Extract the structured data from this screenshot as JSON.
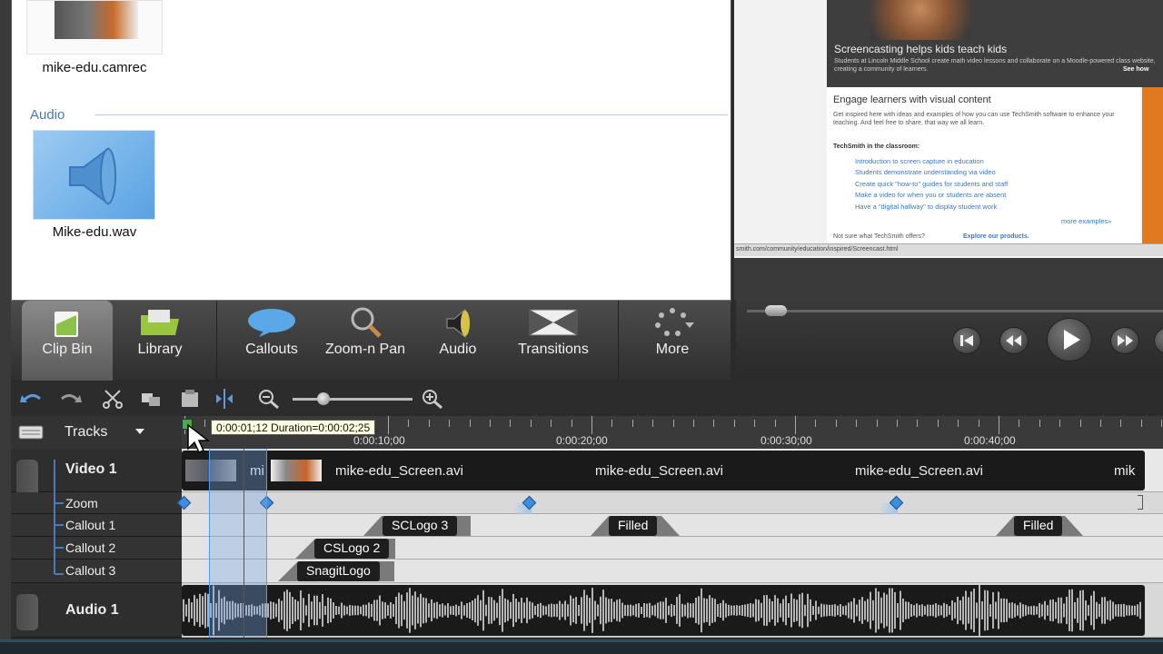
{
  "clip_bin": {
    "video_clip": {
      "label": "mike-edu.camrec"
    },
    "audio_section": {
      "header": "Audio"
    },
    "audio_clip": {
      "label": "Mike-edu.wav"
    }
  },
  "preview": {
    "banner_title": "Screencasting helps kids teach kids",
    "banner_sub": "Students at Lincoln Middle School create math video lessons and collaborate on a Moodle-powered class website, creating a community of learners.",
    "see_how": "See how",
    "heading": "Engage learners with visual content",
    "intro": "Get inspired here with ideas and examples of how you can use TechSmith software to enhance your teaching. And feel free to share, that way we all learn.",
    "share": "share,",
    "subheading": "TechSmith in the classroom:",
    "links": [
      "Introduction to screen capture in education",
      "Students demonstrate understanding via video",
      "Create quick \"how-to\" guides for students and staff",
      "Make a video for when you or students are absent",
      "Have a \"digital hallway\" to display student work"
    ],
    "more_examples": "more examples»",
    "footer_q": "Not sure what TechSmith offers?",
    "footer_link": "Explore our products.",
    "status_url": "smith.com/community/education/inspired/Screencast.html"
  },
  "toolbar": {
    "tabs": [
      {
        "label": "Clip Bin",
        "icon": "clip-bin-icon",
        "active": true
      },
      {
        "label": "Library",
        "icon": "library-folder-icon"
      },
      {
        "label": "Callouts",
        "icon": "speech-bubble-icon"
      },
      {
        "label": "Zoom-n Pan",
        "icon": "magnifier-icon"
      },
      {
        "label": "Audio",
        "icon": "speaker-icon"
      },
      {
        "label": "Transitions",
        "icon": "transitions-icon"
      },
      {
        "label": "More",
        "icon": "more-dots-icon"
      }
    ]
  },
  "timeline": {
    "tracks_label": "Tracks",
    "tooltip": "0:00:01;12  Duration=0:00:02;25",
    "ruler_labels": [
      "0:00:10;00",
      "0:00:20;00",
      "0:00:30;00",
      "0:00:40;00"
    ],
    "tracks": {
      "video": "Video 1",
      "zoom": "Zoom",
      "callout1": "Callout 1",
      "callout2": "Callout 2",
      "callout3": "Callout 3",
      "audio": "Audio 1"
    },
    "video_clips": [
      "mi",
      "mike-edu_Screen.avi",
      "mike-edu_Screen.avi",
      "mike-edu_Screen.avi",
      "mik"
    ],
    "callouts": {
      "c1": [
        "SCLogo 3",
        "Filled",
        "Filled"
      ],
      "c2": [
        "CSLogo 2"
      ],
      "c3": [
        "SnagitLogo"
      ]
    }
  }
}
